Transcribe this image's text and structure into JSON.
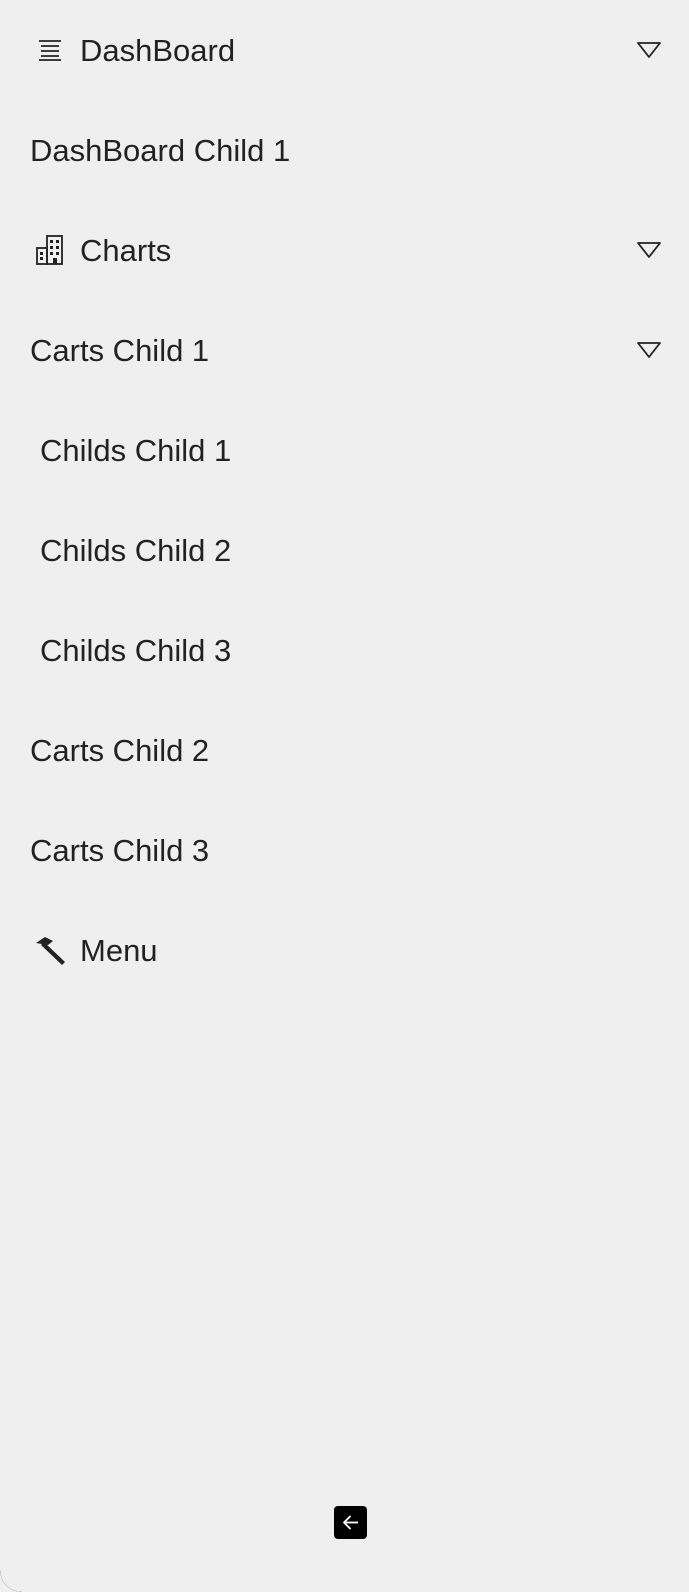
{
  "sidebar": {
    "items": [
      {
        "label": "DashBoard",
        "icon": "list-lines-icon",
        "expandable": true
      },
      {
        "label": "DashBoard Child 1"
      },
      {
        "label": "Charts",
        "icon": "building-icon",
        "expandable": true
      },
      {
        "label": "Carts Child 1",
        "expandable": true
      },
      {
        "label": "Childs Child 1"
      },
      {
        "label": "Childs Child 2"
      },
      {
        "label": "Childs Child 3"
      },
      {
        "label": "Carts Child 2"
      },
      {
        "label": "Carts Child 3"
      },
      {
        "label": "Menu",
        "icon": "hammer-icon"
      }
    ]
  },
  "footer": {
    "collapse_icon": "arrow-left-icon"
  },
  "colors": {
    "background": "#efefef",
    "text": "#222222",
    "button": "#000000"
  }
}
